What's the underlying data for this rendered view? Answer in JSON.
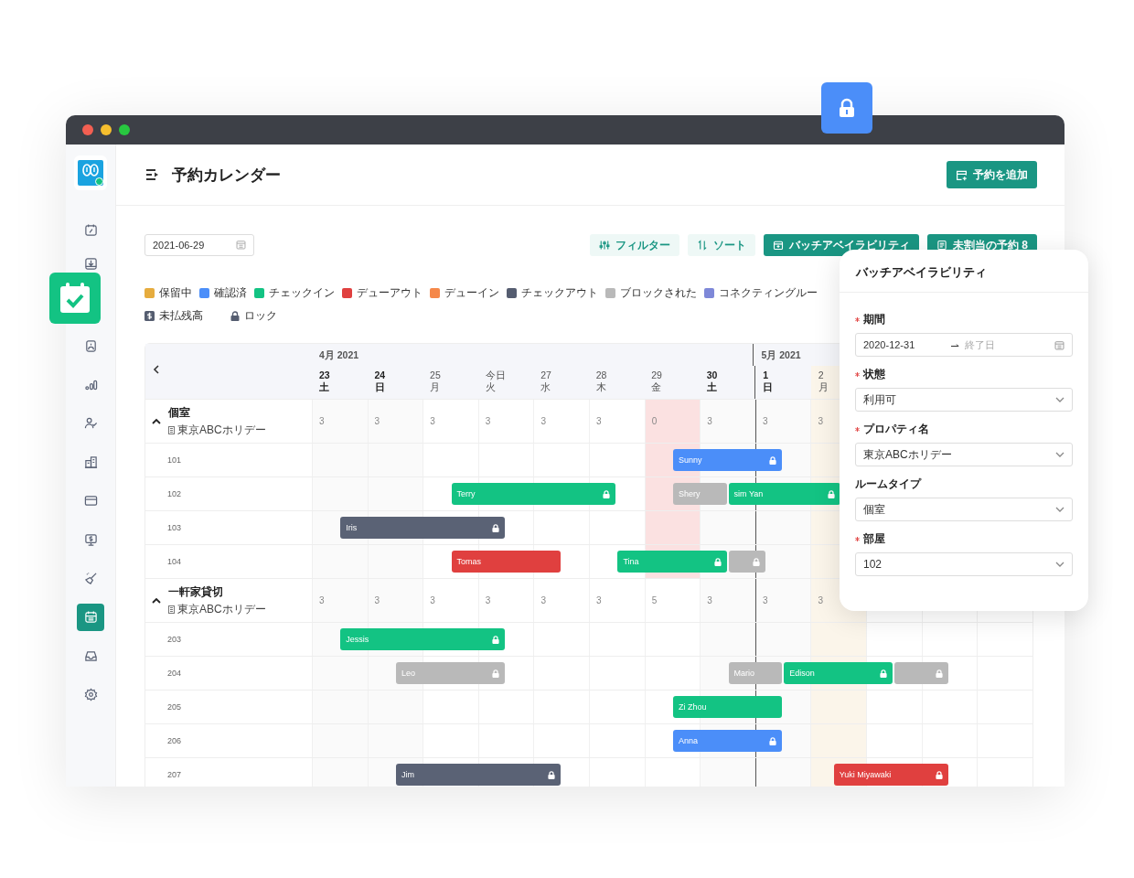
{
  "page_title": "予約カレンダー",
  "add_button": "予約を追加",
  "sidebar": {
    "items": [
      {
        "selected": false
      },
      {
        "selected": false
      },
      {
        "selected": false
      },
      {
        "selected": false
      },
      {
        "selected": false
      },
      {
        "selected": false
      },
      {
        "selected": false
      },
      {
        "selected": false
      },
      {
        "selected": false
      },
      {
        "selected": true
      },
      {
        "selected": false
      },
      {
        "selected": false
      }
    ]
  },
  "toolbar": {
    "date": "2021-06-29",
    "buttons": [
      {
        "label": "フィルター",
        "kind": "light"
      },
      {
        "label": "ソート",
        "kind": "light"
      },
      {
        "label": "バッチアベイラビリティ",
        "kind": "solid"
      },
      {
        "label": "未割当の予約 8",
        "kind": "solid"
      }
    ]
  },
  "legend": {
    "statuses": [
      {
        "label": "保留中",
        "color": "#e6ac3e"
      },
      {
        "label": "確認済",
        "color": "#4b8ef9"
      },
      {
        "label": "チェックイン",
        "color": "#13c383"
      },
      {
        "label": "デューアウト",
        "color": "#e0403f"
      },
      {
        "label": "デューイン",
        "color": "#f5884a"
      },
      {
        "label": "チェックアウト",
        "color": "#555d70"
      },
      {
        "label": "ブロックされた",
        "color": "#b9b9b9"
      },
      {
        "label": "コネクティングルー",
        "color": "#7e88d8"
      }
    ],
    "marks": [
      {
        "kind": "dollar",
        "label": "未払残高"
      },
      {
        "kind": "lock",
        "label": "ロック"
      }
    ]
  },
  "calendar": {
    "months": [
      {
        "label": "4月 2021",
        "days": [
          {
            "date": "23",
            "weekday": "土",
            "weekend": true,
            "holiday": false
          },
          {
            "date": "24",
            "weekday": "日",
            "weekend": true,
            "holiday": false
          },
          {
            "date": "25",
            "weekday": "月",
            "weekend": false,
            "holiday": false
          },
          {
            "date": "今日",
            "weekday": "火",
            "weekend": false,
            "holiday": false
          },
          {
            "date": "27",
            "weekday": "水",
            "weekend": false,
            "holiday": false
          },
          {
            "date": "28",
            "weekday": "木",
            "weekend": false,
            "holiday": false
          },
          {
            "date": "29",
            "weekday": "金",
            "weekend": false,
            "holiday": false
          },
          {
            "date": "30",
            "weekday": "土",
            "weekend": true,
            "holiday": false
          }
        ]
      },
      {
        "label": "5月 2021",
        "days": [
          {
            "date": "1",
            "weekday": "日",
            "weekend": true,
            "holiday": false
          },
          {
            "date": "2",
            "weekday": "月",
            "weekend": false,
            "holiday": true
          }
        ]
      }
    ],
    "groups": [
      {
        "name": "個室",
        "property": "東京ABCホリデー",
        "expanded": true,
        "counts": [
          {
            "value": "3",
            "sold_out": false
          },
          {
            "value": "3",
            "sold_out": false
          },
          {
            "value": "3",
            "sold_out": false
          },
          {
            "value": "3",
            "sold_out": false
          },
          {
            "value": "3",
            "sold_out": false
          },
          {
            "value": "3",
            "sold_out": false
          },
          {
            "value": "0",
            "sold_out": true
          },
          {
            "value": "3",
            "sold_out": false
          },
          {
            "value": "3",
            "sold_out": false
          },
          {
            "value": "3",
            "sold_out": false
          }
        ],
        "rooms": [
          {
            "name": "101",
            "bookings": [
              {
                "guest": "Sunny",
                "color": "#4b8ef9",
                "locked": true
              }
            ]
          },
          {
            "name": "102",
            "bookings": [
              {
                "guest": "Terry",
                "color": "#13c383",
                "locked": true
              },
              {
                "guest": "Shery",
                "color": "#b9b9b9",
                "locked": false
              },
              {
                "guest": "sim Yan",
                "color": "#13c383",
                "locked": true
              }
            ]
          },
          {
            "name": "103",
            "bookings": [
              {
                "guest": "Iris",
                "color": "#5a6275",
                "locked": true
              }
            ]
          },
          {
            "name": "104",
            "bookings": [
              {
                "guest": "Tomas",
                "color": "#e0403f",
                "locked": false
              },
              {
                "guest": "Tina",
                "color": "#13c383",
                "locked": true
              },
              {
                "color": "#b9b9b9",
                "locked": true
              }
            ]
          }
        ]
      },
      {
        "name": "一軒家貸切",
        "property": "東京ABCホリデー",
        "expanded": true,
        "counts": [
          {
            "value": "3",
            "sold_out": false
          },
          {
            "value": "3",
            "sold_out": false
          },
          {
            "value": "3",
            "sold_out": false
          },
          {
            "value": "3",
            "sold_out": false
          },
          {
            "value": "3",
            "sold_out": false
          },
          {
            "value": "3",
            "sold_out": false
          },
          {
            "value": "5",
            "sold_out": false
          },
          {
            "value": "3",
            "sold_out": false
          },
          {
            "value": "3",
            "sold_out": false
          },
          {
            "value": "3",
            "sold_out": false
          }
        ],
        "rooms": [
          {
            "name": "203",
            "bookings": [
              {
                "guest": "Jessis",
                "color": "#13c383",
                "locked": true
              }
            ]
          },
          {
            "name": "204",
            "bookings": [
              {
                "guest": "Leo",
                "color": "#b9b9b9",
                "locked": true
              },
              {
                "guest": "Mario",
                "color": "#b9b9b9",
                "locked": false
              },
              {
                "guest": "Edison",
                "color": "#13c383",
                "locked": true
              },
              {
                "color": "#b9b9b9",
                "locked": true
              }
            ]
          },
          {
            "name": "205",
            "bookings": [
              {
                "guest": "Zi Zhou",
                "color": "#13c383",
                "locked": false
              }
            ]
          },
          {
            "name": "206",
            "bookings": [
              {
                "guest": "Anna",
                "color": "#4b8ef9",
                "locked": true
              }
            ]
          },
          {
            "name": "207",
            "bookings": [
              {
                "guest": "Jim",
                "color": "#5a6275",
                "locked": true
              },
              {
                "guest": "Yuki Miyawaki",
                "color": "#e0403f",
                "locked": true
              }
            ]
          }
        ]
      }
    ]
  },
  "batch_panel": {
    "title": "バッチアベイラビリティ",
    "fields": [
      {
        "label": "期間",
        "required": true,
        "kind": "daterange",
        "value": "2020-12-31",
        "placeholder": "終了日"
      },
      {
        "label": "状態",
        "required": true,
        "kind": "select",
        "value": "利用可"
      },
      {
        "label": "プロパティ名",
        "required": true,
        "kind": "select",
        "value": "東京ABCホリデー"
      },
      {
        "label": "ルームタイプ",
        "required": false,
        "kind": "select",
        "value": "個室"
      },
      {
        "label": "部屋",
        "required": true,
        "kind": "select",
        "value": "102"
      }
    ]
  }
}
